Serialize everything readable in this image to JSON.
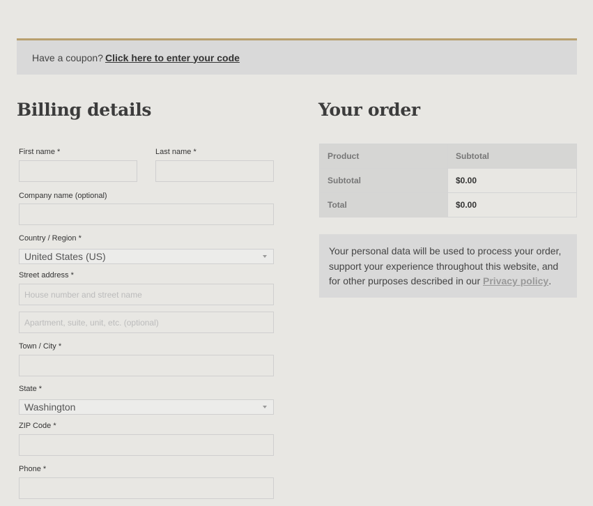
{
  "coupon": {
    "prompt": "Have a coupon?",
    "link": "Click here to enter your code"
  },
  "billing": {
    "title": "Billing details",
    "fields": {
      "first_name": {
        "label": "First name",
        "required": "*",
        "value": ""
      },
      "last_name": {
        "label": "Last name",
        "required": "*",
        "value": ""
      },
      "company": {
        "label": "Company name (optional)",
        "value": ""
      },
      "country": {
        "label": "Country / Region",
        "required": "*",
        "value": "United States (US)"
      },
      "street": {
        "label": "Street address",
        "required": "*",
        "placeholder1": "House number and street name",
        "placeholder2": "Apartment, suite, unit, etc. (optional)"
      },
      "city": {
        "label": "Town / City",
        "required": "*",
        "value": ""
      },
      "state": {
        "label": "State",
        "required": "*",
        "value": "Washington"
      },
      "zip": {
        "label": "ZIP Code",
        "required": "*",
        "value": ""
      },
      "phone": {
        "label": "Phone",
        "required": "*",
        "value": ""
      }
    }
  },
  "order": {
    "title": "Your order",
    "table": {
      "header": {
        "product": "Product",
        "subtotal": "Subtotal"
      },
      "rows": [
        {
          "label": "Subtotal",
          "value": "$0.00"
        },
        {
          "label": "Total",
          "value": "$0.00"
        }
      ]
    },
    "privacy": {
      "text": "Your personal data will be used to process your order, support your experience throughout this website, and for other purposes described in our",
      "link": "Privacy policy",
      "end": "."
    }
  },
  "colors": {
    "accent": "#b9a06e",
    "background": "#e8e7e3",
    "panel": "#d9d9d9"
  }
}
